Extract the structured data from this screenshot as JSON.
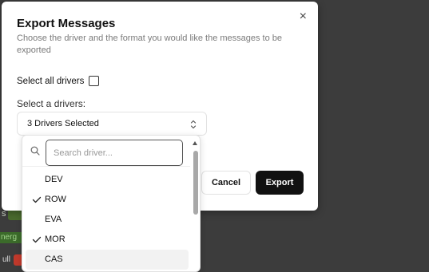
{
  "background": {
    "fragment_1": "s",
    "fragment_2": "nerg",
    "fragment_3": "ull"
  },
  "modal": {
    "title": "Export Messages",
    "subtitle": "Choose the driver and the format you would like the messages to be exported",
    "select_all_label": "Select all drivers",
    "select_all_checked": false,
    "select_label": "Select a drivers:",
    "select_value": "3 Drivers Selected",
    "cancel_label": "Cancel",
    "export_label": "Export",
    "close_icon": "×"
  },
  "dropdown": {
    "search_placeholder": "Search driver...",
    "search_value": "",
    "options": [
      {
        "label": "DEV",
        "checked": false
      },
      {
        "label": "ROW",
        "checked": true
      },
      {
        "label": "EVA",
        "checked": false
      },
      {
        "label": "MOR",
        "checked": true
      },
      {
        "label": "CAS",
        "checked": false,
        "hovered": true
      }
    ]
  },
  "colors": {
    "export_button": "#111111",
    "backdrop": "#3c3c3c"
  }
}
